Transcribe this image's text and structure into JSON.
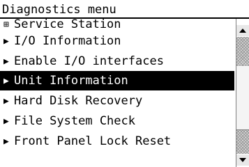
{
  "menu": {
    "title": "Diagnostics menu",
    "items": [
      {
        "label": "Service Station",
        "marker": "⊞",
        "kind": "expandable",
        "selected": false
      },
      {
        "label": "I/O Information",
        "marker": "▶",
        "kind": "action",
        "selected": false
      },
      {
        "label": "Enable I/O interfaces",
        "marker": "▶",
        "kind": "action",
        "selected": false
      },
      {
        "label": "Unit Information",
        "marker": "▶",
        "kind": "action",
        "selected": true
      },
      {
        "label": "Hard Disk Recovery",
        "marker": "▶",
        "kind": "action",
        "selected": false
      },
      {
        "label": "File System Check",
        "marker": "▶",
        "kind": "action",
        "selected": false
      },
      {
        "label": "Front Panel Lock Reset",
        "marker": "▶",
        "kind": "action",
        "selected": false
      }
    ]
  },
  "scrollbar": {
    "up_icon": "arrow-up-icon",
    "down_icon": "arrow-down-icon",
    "scroll_position": 0.55,
    "visible_fraction": 0.55
  },
  "colors": {
    "selection_background": "#000000",
    "selection_text": "#ffffff"
  }
}
